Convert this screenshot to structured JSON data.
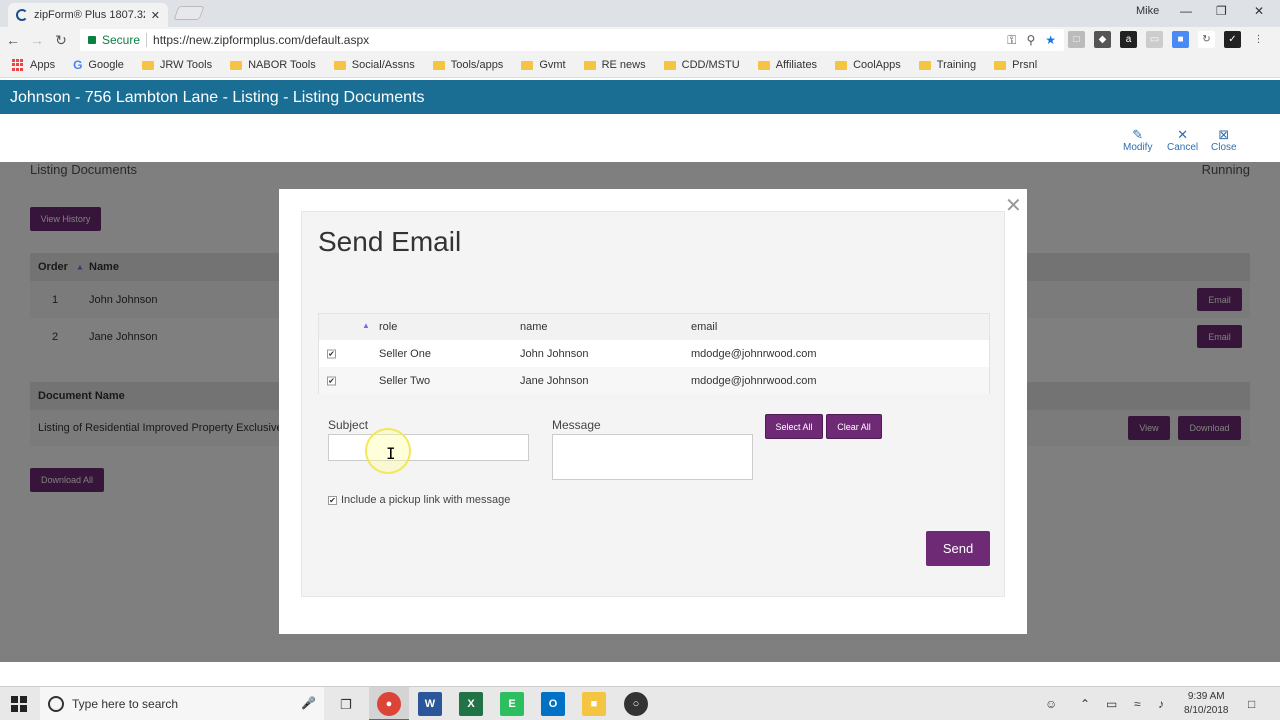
{
  "browser": {
    "tab_title": "zipForm® Plus 1807.32",
    "tab_close": "✕",
    "user": "Mike",
    "secure_label": "Secure",
    "url": "https://new.zipformplus.com/default.aspx",
    "bookmarks": [
      "Apps",
      "Google",
      "JRW Tools",
      "NABOR Tools",
      "Social/Assns",
      "Tools/apps",
      "Gvmt",
      "RE news",
      "CDD/MSTU",
      "Affiliates",
      "CoolApps",
      "Training",
      "Prsnl"
    ]
  },
  "app": {
    "header_title": "Johnson - 756 Lambton Lane - Listing - Listing Documents",
    "actions": {
      "modify": "Modify",
      "cancel": "Cancel",
      "close": "Close"
    }
  },
  "page": {
    "section_title": "Listing Documents",
    "status": "Running",
    "view_history": "View History",
    "signers_headers": {
      "order": "Order",
      "name": "Name"
    },
    "signers": [
      {
        "order": "1",
        "name": "John Johnson",
        "action": "Email"
      },
      {
        "order": "2",
        "name": "Jane Johnson",
        "action": "Email"
      }
    ],
    "doc_header": "Document Name",
    "documents": [
      {
        "name": "Listing of Residential Improved Property Exclusive",
        "view": "View",
        "download": "Download"
      }
    ],
    "download_all": "Download All"
  },
  "modal": {
    "title": "Send Email",
    "close": "✕",
    "table_headers": {
      "role": "role",
      "name": "name",
      "email": "email"
    },
    "recipients": [
      {
        "checked": true,
        "role": "Seller One",
        "name": "John Johnson",
        "email": "mdodge@johnrwood.com"
      },
      {
        "checked": true,
        "role": "Seller Two",
        "name": "Jane Johnson",
        "email": "mdodge@johnrwood.com"
      }
    ],
    "subject_label": "Subject",
    "subject_value": "",
    "message_label": "Message",
    "message_value": "",
    "select_all": "Select All",
    "clear_all": "Clear All",
    "pickup_label": "Include a pickup link with message",
    "pickup_checked": true,
    "send": "Send"
  },
  "taskbar": {
    "search_placeholder": "Type here to search",
    "time": "9:39 AM",
    "date": "8/10/2018"
  },
  "colors": {
    "header_blue": "#1b6e93",
    "accent_purple": "#6f2a76",
    "link_blue": "#2f6fb0"
  }
}
